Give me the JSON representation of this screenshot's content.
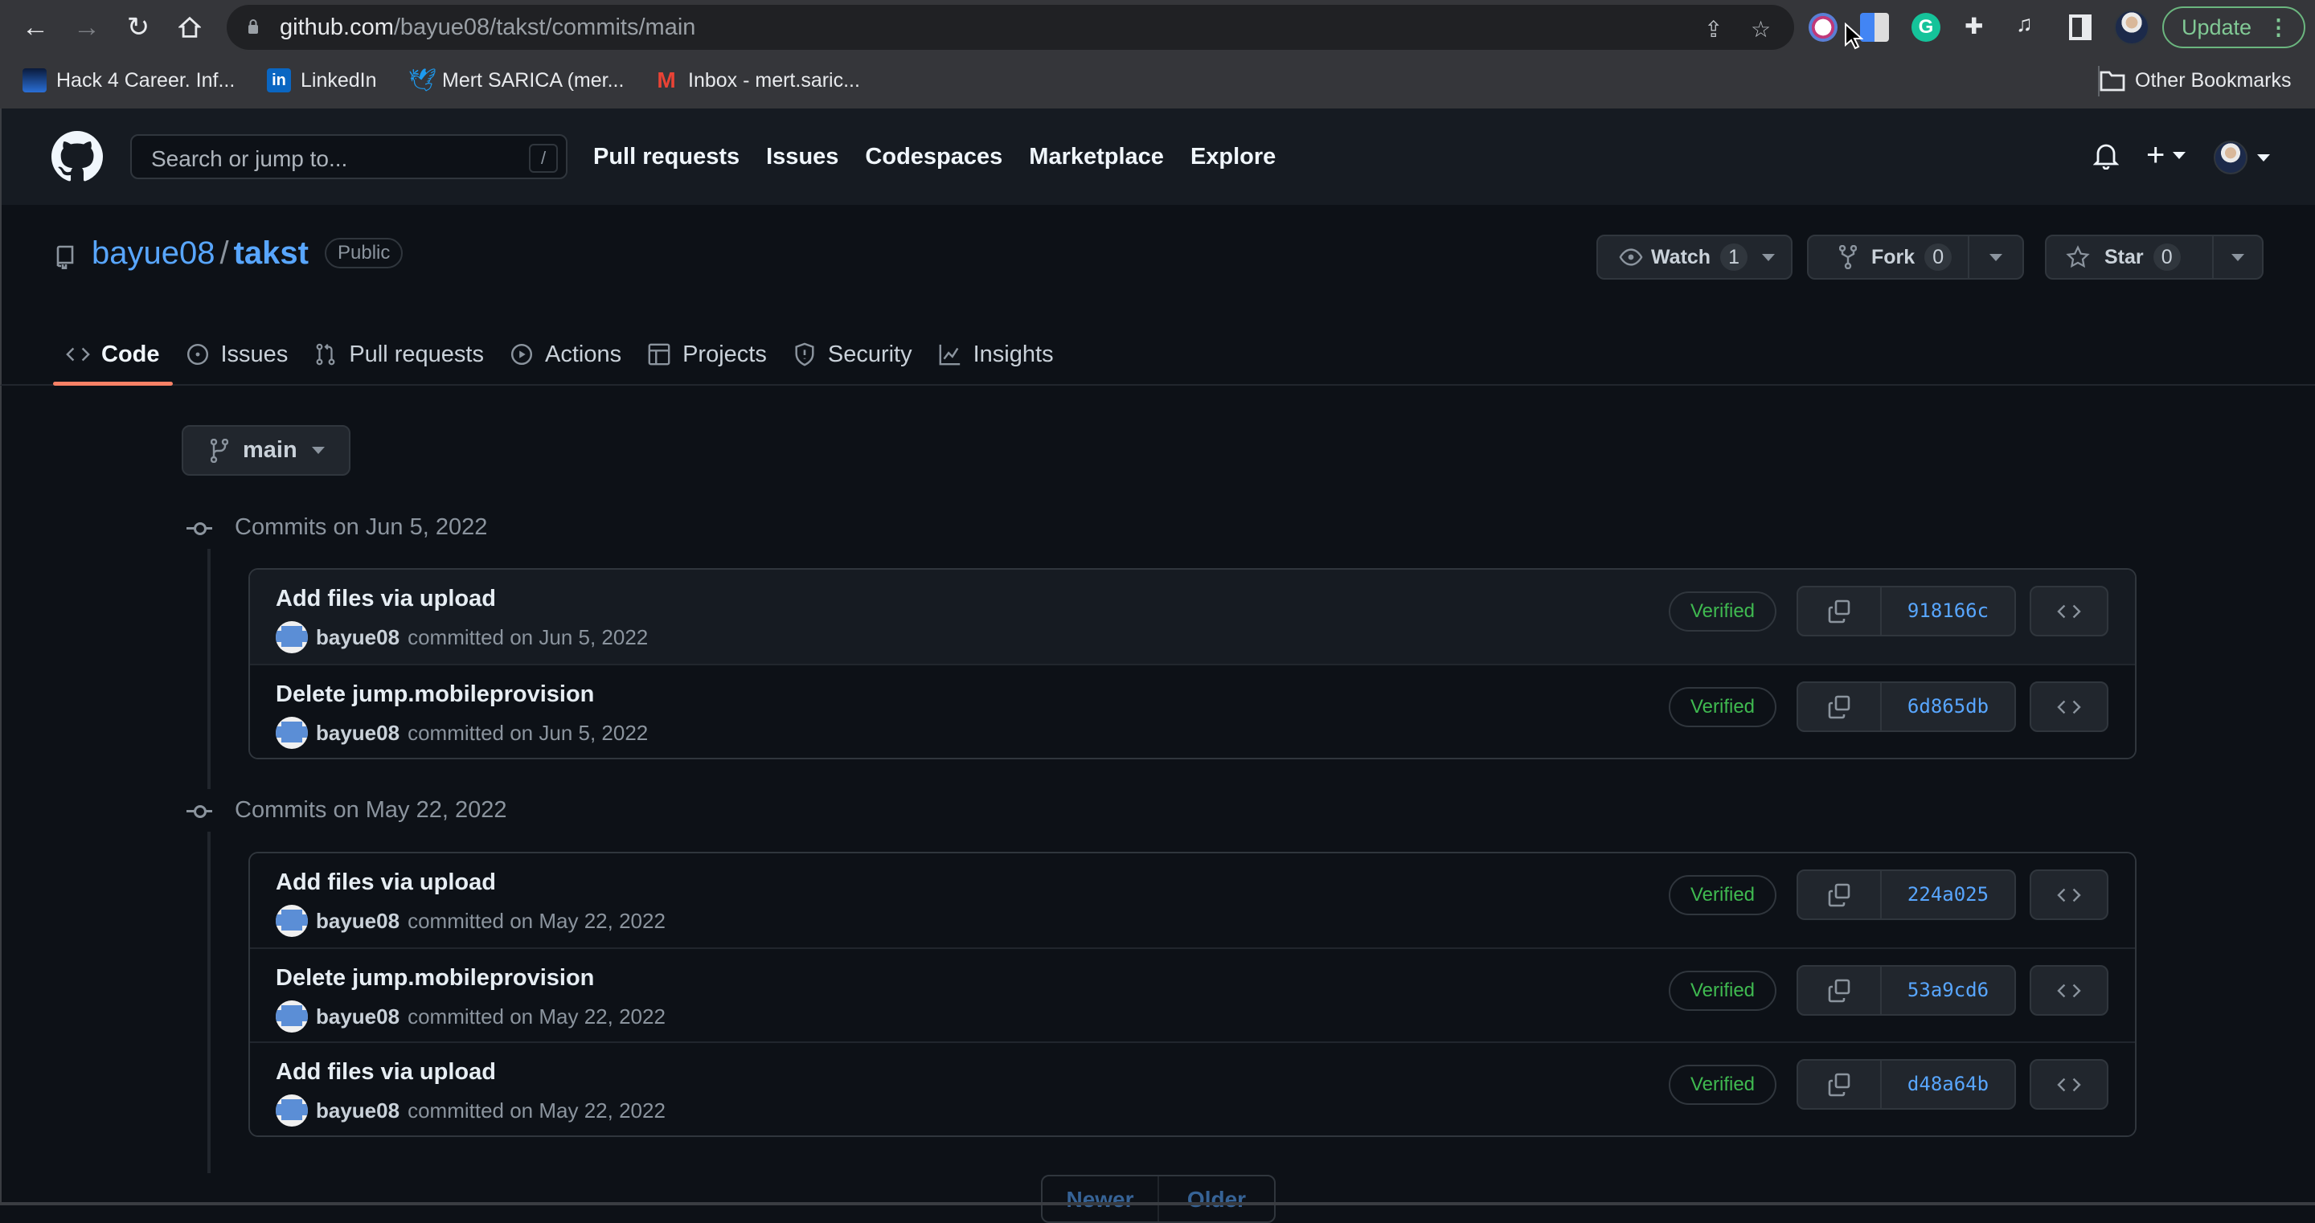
{
  "browser": {
    "url_host": "github.com",
    "url_path": "/bayue08/takst/commits/main",
    "update_label": "Update",
    "bookmarks": [
      {
        "label": "Hack 4 Career. Inf...",
        "icon": "hack4career-icon"
      },
      {
        "label": "LinkedIn",
        "icon": "linkedin-icon"
      },
      {
        "label": "Mert SARICA (mer...",
        "icon": "twitter-icon"
      },
      {
        "label": "Inbox - mert.saric...",
        "icon": "gmail-icon"
      }
    ],
    "other_bookmarks": "Other Bookmarks"
  },
  "header": {
    "search_placeholder": "Search or jump to...",
    "search_shortcut": "/",
    "nav": [
      "Pull requests",
      "Issues",
      "Codespaces",
      "Marketplace",
      "Explore"
    ]
  },
  "repo": {
    "owner": "bayue08",
    "separator": "/",
    "name": "takst",
    "visibility": "Public",
    "watch_label": "Watch",
    "watch_count": "1",
    "fork_label": "Fork",
    "fork_count": "0",
    "star_label": "Star",
    "star_count": "0",
    "tabs": [
      {
        "label": "Code",
        "icon": "code-icon",
        "active": true
      },
      {
        "label": "Issues",
        "icon": "issue-icon"
      },
      {
        "label": "Pull requests",
        "icon": "pull-request-icon"
      },
      {
        "label": "Actions",
        "icon": "play-icon"
      },
      {
        "label": "Projects",
        "icon": "table-icon"
      },
      {
        "label": "Security",
        "icon": "shield-icon"
      },
      {
        "label": "Insights",
        "icon": "graph-icon"
      }
    ]
  },
  "branch": "main",
  "commit_groups": [
    {
      "title": "Commits on Jun 5, 2022",
      "commits": [
        {
          "message": "Add files via upload",
          "author": "bayue08",
          "when": "committed on Jun 5, 2022",
          "verified": "Verified",
          "sha": "918166c"
        },
        {
          "message": "Delete jump.mobileprovision",
          "author": "bayue08",
          "when": "committed on Jun 5, 2022",
          "verified": "Verified",
          "sha": "6d865db"
        }
      ]
    },
    {
      "title": "Commits on May 22, 2022",
      "commits": [
        {
          "message": "Add files via upload",
          "author": "bayue08",
          "when": "committed on May 22, 2022",
          "verified": "Verified",
          "sha": "224a025"
        },
        {
          "message": "Delete jump.mobileprovision",
          "author": "bayue08",
          "when": "committed on May 22, 2022",
          "verified": "Verified",
          "sha": "53a9cd6"
        },
        {
          "message": "Add files via upload",
          "author": "bayue08",
          "when": "committed on May 22, 2022",
          "verified": "Verified",
          "sha": "d48a64b"
        }
      ]
    }
  ],
  "pagination": {
    "newer": "Newer",
    "older": "Older"
  },
  "colors": {
    "accent_link": "#58a6ff",
    "verified": "#3fb950",
    "active_tab": "#f78166",
    "background": "#0d1117"
  }
}
